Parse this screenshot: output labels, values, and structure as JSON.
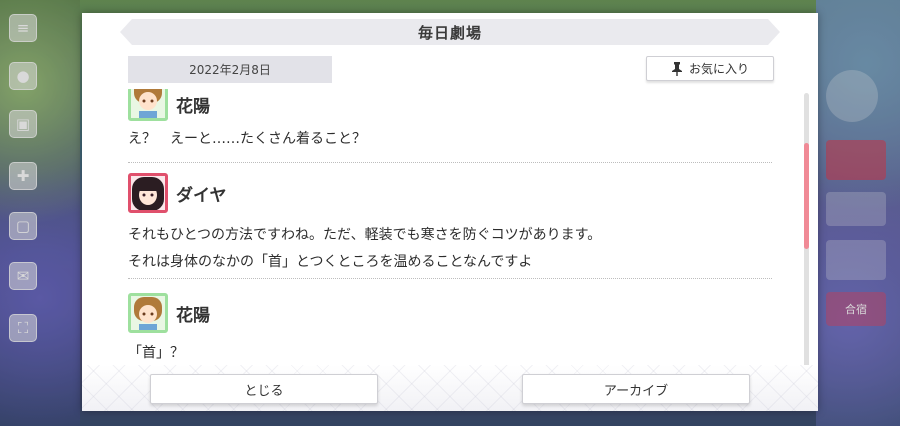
{
  "dialog": {
    "title": "毎日劇場",
    "date": "2022年2月8日",
    "favorite_label": "お気に入り",
    "close_label": "とじる",
    "archive_label": "アーカイブ"
  },
  "entries": [
    {
      "speaker": "花陽",
      "lines": [
        "え？　えーと……たくさん着ること？"
      ]
    },
    {
      "speaker": "ダイヤ",
      "lines": [
        "それもひとつの方法ですわね。ただ、軽装でも寒さを防ぐコツがあります。",
        "それは身体のなかの「首」とつくところを温めることなんですよ"
      ]
    },
    {
      "speaker": "花陽",
      "lines": [
        "「首」？"
      ]
    }
  ],
  "background": {
    "right_labels": [
      "合宿"
    ],
    "colors": {
      "accent_scroll": "#f08a96",
      "avatar_green": "#9ee09e",
      "avatar_red": "#e0506c"
    }
  }
}
